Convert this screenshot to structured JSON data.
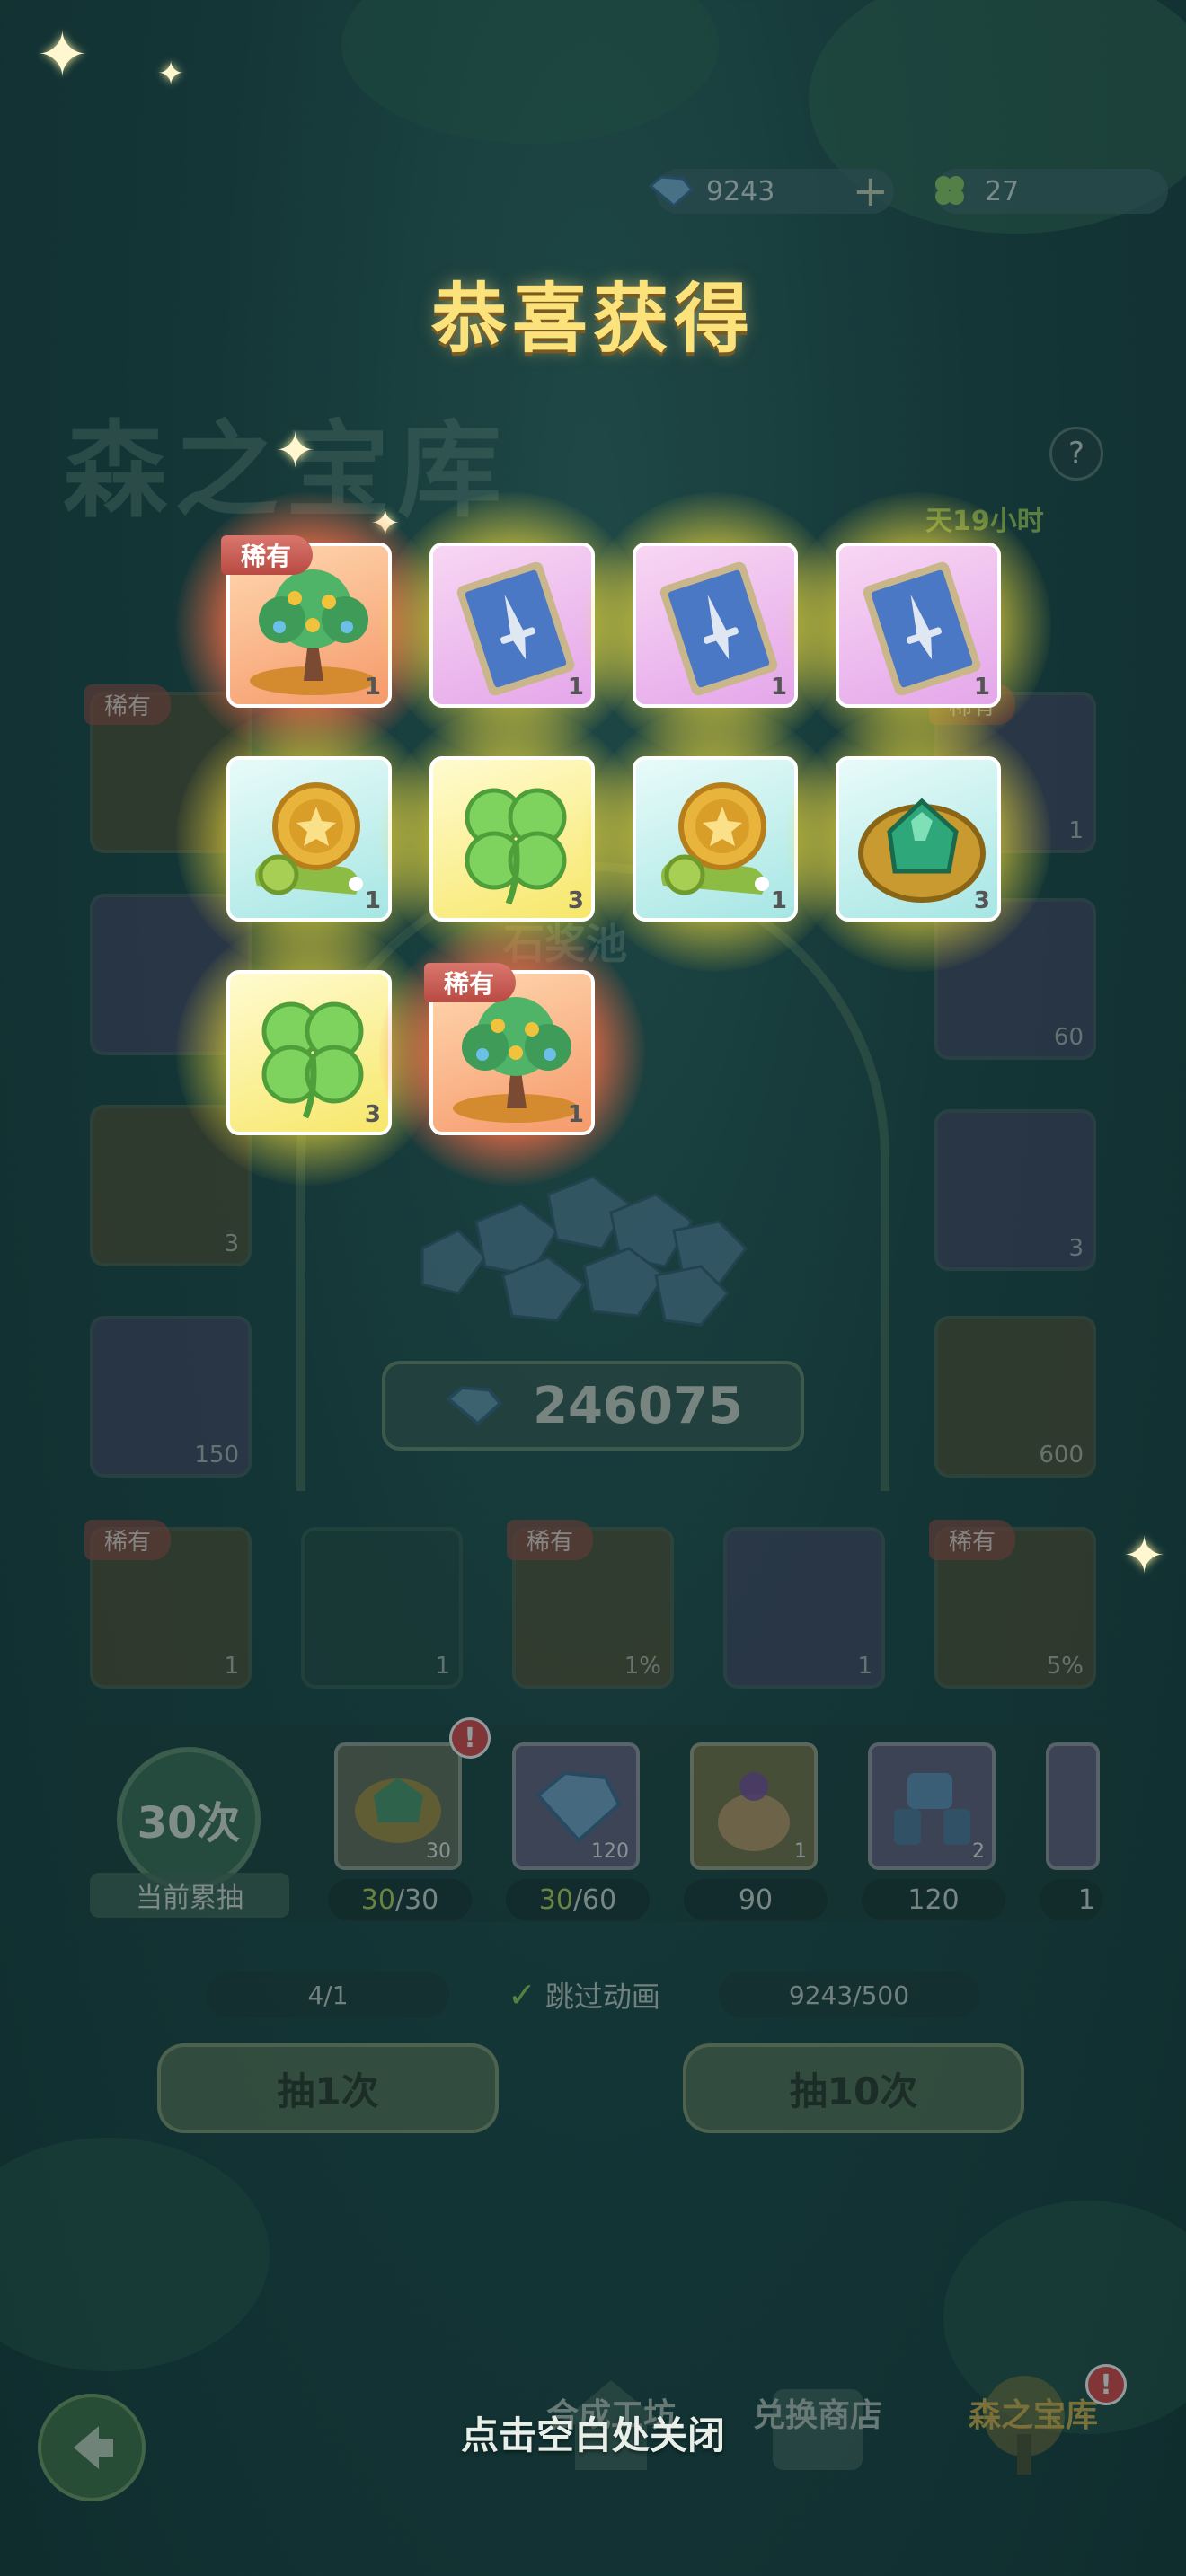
{
  "currency": {
    "gems": "9243",
    "clovers": "27",
    "add_symbol": "+"
  },
  "page_title_bg": "森之宝库",
  "help_symbol": "?",
  "timer_text": "天19小时",
  "pool": {
    "subtitle_partial": "石奖池",
    "total": "246075"
  },
  "bg_tiles": {
    "rare_label": "稀有",
    "left_col": [
      "",
      "",
      "3",
      "150"
    ],
    "right_col": [
      "1",
      "60",
      "3",
      "600"
    ],
    "bottom_row": [
      "1",
      "1",
      "1%",
      "1",
      "5%"
    ]
  },
  "progress": {
    "count": "30次",
    "count_label": "当前累抽",
    "rewards": [
      {
        "num": "30",
        "need_done": "30",
        "need_total": "/30",
        "icon": "emerald-ring-icon",
        "alert": "!"
      },
      {
        "num": "120",
        "need_done": "30",
        "need_total": "/60",
        "icon": "gem-icon"
      },
      {
        "num": "1",
        "need_done": "",
        "need_total": "90",
        "icon": "treasure-bag-icon"
      },
      {
        "num": "2",
        "need_done": "",
        "need_total": "120",
        "icon": "mech-armor-icon"
      },
      {
        "num": "",
        "need_done": "",
        "need_total": "1",
        "icon": "card-icon"
      }
    ]
  },
  "status": {
    "tickets": "4/1",
    "skip_anim": "跳过动画",
    "gem_cost": "9243/500",
    "check": "✓"
  },
  "buttons": {
    "draw_one": "抽1次",
    "draw_ten": "抽10次"
  },
  "nav": {
    "items": [
      "合成工坊",
      "兑换商店",
      "森之宝库"
    ],
    "alert": "!"
  },
  "dialog": {
    "title": "恭喜获得",
    "rare_label": "稀有",
    "close_hint": "点击空白处关闭",
    "items": [
      {
        "icon": "money-tree-icon",
        "bg": "orange",
        "glow": "red",
        "rare": true,
        "count": "1"
      },
      {
        "icon": "sword-card-icon",
        "bg": "pink",
        "glow": "gold",
        "rare": false,
        "count": "1"
      },
      {
        "icon": "sword-card-icon",
        "bg": "pink",
        "glow": "gold",
        "rare": false,
        "count": "1"
      },
      {
        "icon": "sword-card-icon",
        "bg": "pink",
        "glow": "gold",
        "rare": false,
        "count": "1"
      },
      {
        "icon": "gold-coin-snail-icon",
        "bg": "cyan",
        "glow": "gold",
        "rare": false,
        "count": "1"
      },
      {
        "icon": "four-leaf-clover-icon",
        "bg": "yellow",
        "glow": "gold",
        "rare": false,
        "count": "3"
      },
      {
        "icon": "gold-coin-snail-icon",
        "bg": "cyan",
        "glow": "gold",
        "rare": false,
        "count": "1"
      },
      {
        "icon": "emerald-ring-icon",
        "bg": "cyan",
        "glow": "gold",
        "rare": false,
        "count": "3"
      },
      {
        "icon": "four-leaf-clover-icon",
        "bg": "yellow",
        "glow": "gold",
        "rare": false,
        "count": "3"
      },
      {
        "icon": "money-tree-icon",
        "bg": "orange",
        "glow": "red",
        "rare": true,
        "count": "1"
      }
    ]
  },
  "colors": {
    "title": "#fbe27a",
    "glow_gold": "#f0dc3c",
    "glow_red": "#f56e46",
    "rare_tag": "#c85a52",
    "progress_highlight": "#b9d65a",
    "timer": "#9fcd56"
  }
}
